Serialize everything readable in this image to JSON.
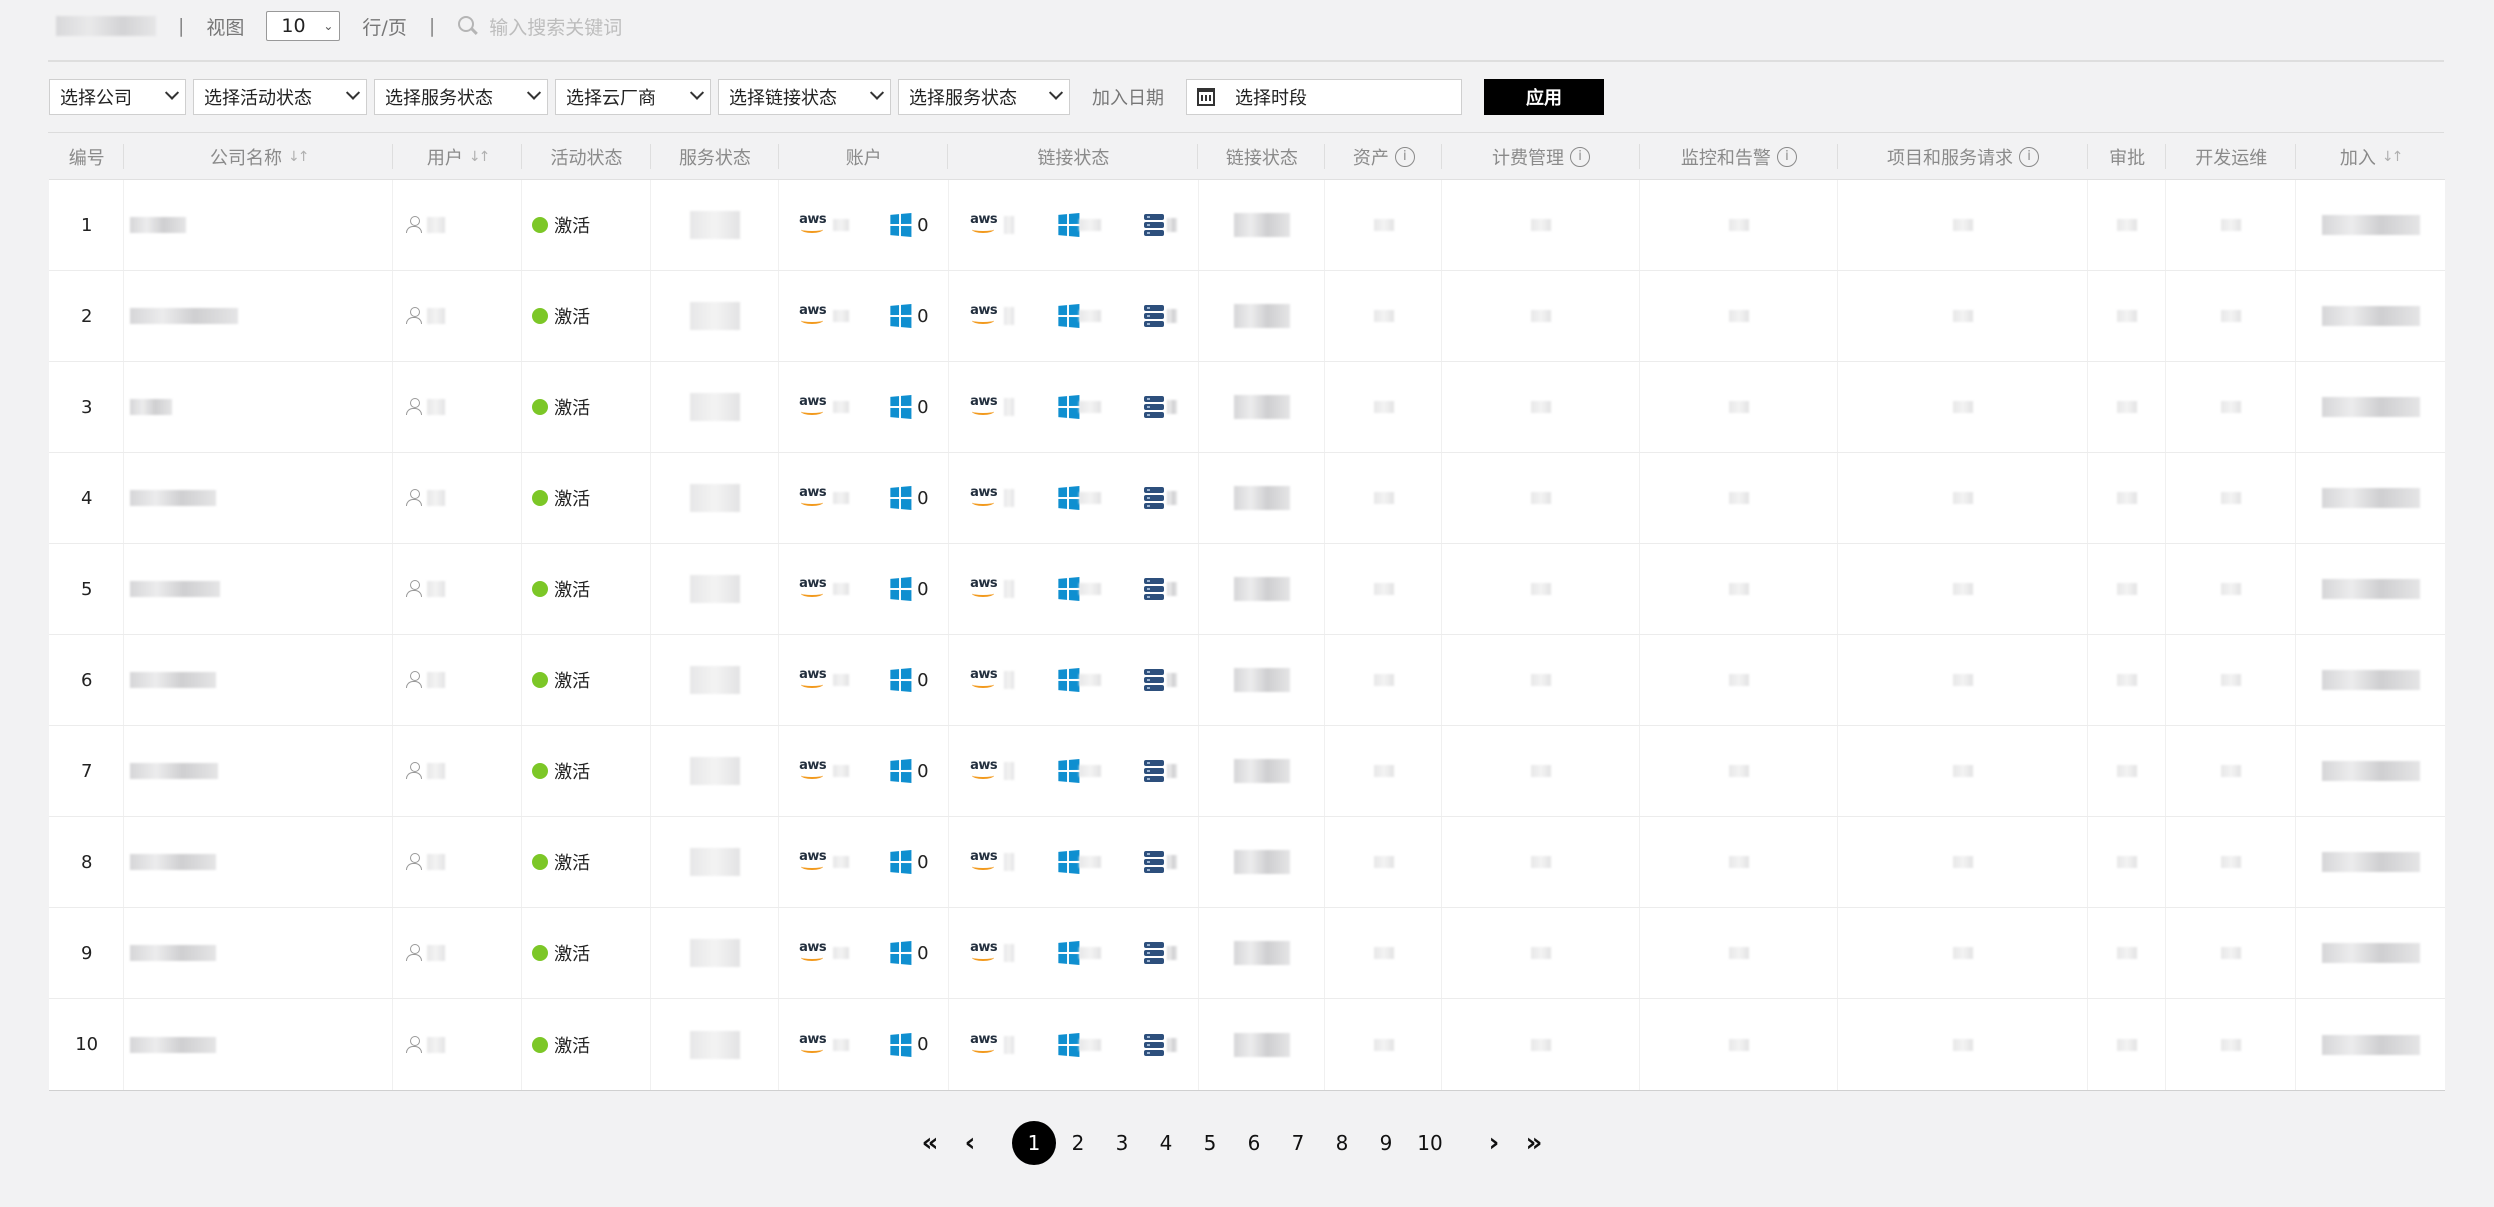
{
  "toolbar": {
    "view_label": "视图",
    "per_page_value": "10",
    "per_page_suffix": "行/页",
    "search_placeholder": "输入搜索关键词"
  },
  "filters": {
    "company": "选择公司",
    "activity_status": "选择活动状态",
    "service_status_1": "选择服务状态",
    "cloud_vendor": "选择云厂商",
    "link_status": "选择链接状态",
    "service_status_2": "选择服务状态",
    "join_date_label": "加入日期",
    "date_placeholder": "选择时段",
    "apply_label": "应用"
  },
  "table": {
    "headers": {
      "no": "编号",
      "company": "公司名称",
      "user": "用户",
      "activity": "活动状态",
      "service": "服务状态",
      "account": "账户",
      "link_status": "链接状态",
      "link_status_2": "链接状态",
      "assets": "资产",
      "billing": "计费管理",
      "monitoring": "监控和告警",
      "projects": "项目和服务请求",
      "approval": "审批",
      "devops": "开发运维",
      "joined": "加入"
    },
    "rows": [
      {
        "no": "1",
        "status": "激活",
        "azure_count": "0"
      },
      {
        "no": "2",
        "status": "激活",
        "azure_count": "0"
      },
      {
        "no": "3",
        "status": "激活",
        "azure_count": "0"
      },
      {
        "no": "4",
        "status": "激活",
        "azure_count": "0"
      },
      {
        "no": "5",
        "status": "激活",
        "azure_count": "0"
      },
      {
        "no": "6",
        "status": "激活",
        "azure_count": "0"
      },
      {
        "no": "7",
        "status": "激活",
        "azure_count": "0"
      },
      {
        "no": "8",
        "status": "激活",
        "azure_count": "0"
      },
      {
        "no": "9",
        "status": "激活",
        "azure_count": "0"
      },
      {
        "no": "10",
        "status": "激活",
        "azure_count": "0"
      }
    ]
  },
  "pagination": {
    "pages": [
      "1",
      "2",
      "3",
      "4",
      "5",
      "6",
      "7",
      "8",
      "9",
      "10"
    ],
    "current": "1"
  },
  "icons": {
    "account_aws": "aws-logo-icon",
    "account_windows": "windows-logo-icon",
    "link_server": "server-stack-icon",
    "user": "user-icon",
    "calendar": "calendar-icon",
    "search": "search-icon"
  },
  "colors": {
    "active_dot": "#7cc727",
    "apply_button": "#000000",
    "windows_blue": "#0f8fd0",
    "aws_orange": "#f29a1e"
  }
}
